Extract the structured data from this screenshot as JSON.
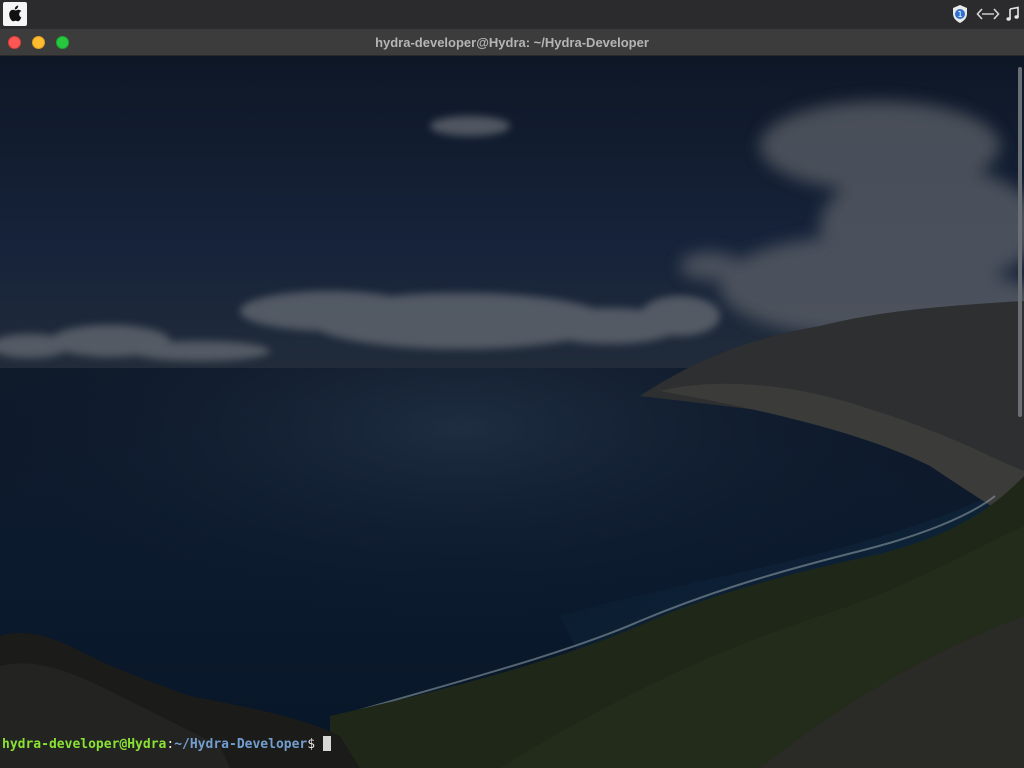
{
  "top_panel": {
    "apple_menu_icon": "apple-icon",
    "tray_icons": [
      "shield-update-icon",
      "code-brackets-icon",
      "music-note-icon"
    ],
    "shield_badge": "1"
  },
  "window": {
    "title": "hydra-developer@Hydra: ~/Hydra-Developer",
    "controls": [
      "close",
      "minimize",
      "maximize"
    ],
    "colors": {
      "close": "#fd5754",
      "minimize": "#febc2e",
      "maximize": "#27c840"
    }
  },
  "terminal": {
    "prompt_user_host": "hydra-developer@Hydra",
    "prompt_colon": ":",
    "prompt_path": "~/Hydra-Developer",
    "prompt_symbol": "$",
    "colors": {
      "user": "#8ae234",
      "path": "#729fcf"
    },
    "background": "coastal-landscape-wallpaper"
  }
}
